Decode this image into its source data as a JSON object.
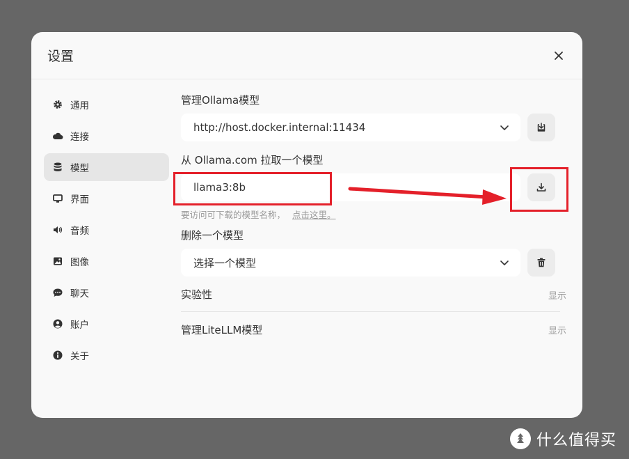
{
  "dialog": {
    "title": "设置"
  },
  "sidebar": {
    "items": [
      {
        "label": "通用",
        "icon": "gear-icon"
      },
      {
        "label": "连接",
        "icon": "cloud-icon"
      },
      {
        "label": "模型",
        "icon": "database-icon",
        "active": true
      },
      {
        "label": "界面",
        "icon": "monitor-icon"
      },
      {
        "label": "音频",
        "icon": "speaker-icon"
      },
      {
        "label": "图像",
        "icon": "image-icon"
      },
      {
        "label": "聊天",
        "icon": "chat-icon"
      },
      {
        "label": "账户",
        "icon": "user-icon"
      },
      {
        "label": "关于",
        "icon": "info-icon"
      }
    ]
  },
  "manage_ollama": {
    "label": "管理Ollama模型",
    "selected_url": "http://host.docker.internal:11434"
  },
  "pull_model": {
    "label": "从 Ollama.com 拉取一个模型",
    "input_value": "llama3:8b",
    "hint_text": "要访问可下载的模型名称，",
    "hint_link": "点击这里。"
  },
  "delete_model": {
    "label": "删除一个模型",
    "placeholder": "选择一个模型"
  },
  "experimental": {
    "label": "实验性",
    "toggle": "显示"
  },
  "litellm": {
    "label": "管理LiteLLM模型",
    "toggle": "显示"
  },
  "watermark": {
    "text": "什么值得买"
  },
  "colors": {
    "annotation_red": "#e4202a",
    "backdrop": "#666666"
  }
}
